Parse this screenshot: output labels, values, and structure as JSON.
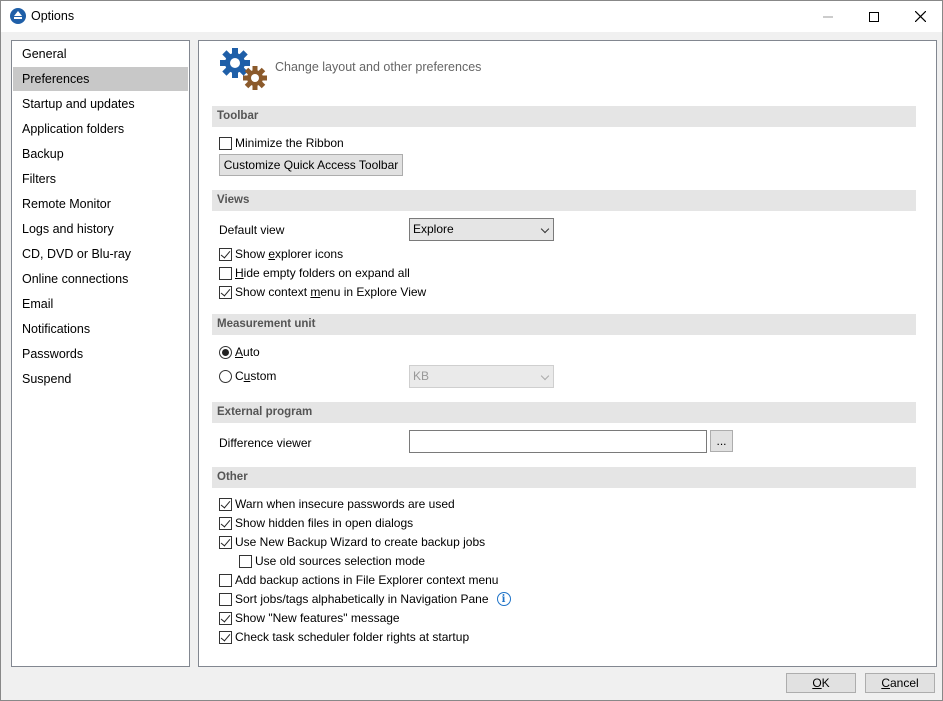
{
  "window": {
    "title": "Options",
    "controls": {
      "minimize": "—",
      "maximize": "☐",
      "close": "✕"
    }
  },
  "sidebar": {
    "items": [
      {
        "label": "General"
      },
      {
        "label": "Preferences",
        "selected": true
      },
      {
        "label": "Startup and updates"
      },
      {
        "label": "Application folders"
      },
      {
        "label": "Backup"
      },
      {
        "label": "Filters"
      },
      {
        "label": "Remote Monitor"
      },
      {
        "label": "Logs and history"
      },
      {
        "label": "CD, DVD or Blu-ray"
      },
      {
        "label": "Online connections"
      },
      {
        "label": "Email"
      },
      {
        "label": "Notifications"
      },
      {
        "label": "Passwords"
      },
      {
        "label": "Suspend"
      }
    ]
  },
  "header": {
    "text": "Change layout and other preferences",
    "icon": "gears-icon",
    "colors": {
      "gear_primary": "#1f5fa8",
      "gear_secondary": "#8b5a2b"
    }
  },
  "toolbar": {
    "section": "Toolbar",
    "minimize_ribbon": {
      "label": "Minimize the Ribbon",
      "checked": false
    },
    "customize_button": "Customize Quick Access Toolbar"
  },
  "views": {
    "section": "Views",
    "default_view_label": "Default view",
    "default_view_value": "Explore",
    "show_explorer_icons": {
      "pre": "Show ",
      "ul": "e",
      "post": "xplorer icons",
      "checked": true
    },
    "hide_empty_folders": {
      "pre": "",
      "ul": "H",
      "post": "ide empty folders on expand all",
      "checked": false
    },
    "show_context_menu": {
      "pre": "Show context ",
      "ul": "m",
      "post": "enu in Explore View",
      "checked": true
    }
  },
  "measurement": {
    "section": "Measurement unit",
    "auto": {
      "pre": "",
      "ul": "A",
      "post": "uto",
      "selected": true
    },
    "custom": {
      "pre": "C",
      "ul": "u",
      "post": "stom",
      "selected": false
    },
    "custom_value": "KB"
  },
  "external": {
    "section": "External program",
    "difference_viewer_label": "Difference viewer",
    "difference_viewer_value": "",
    "browse_label": "..."
  },
  "other": {
    "section": "Other",
    "items": [
      {
        "label": "Warn when insecure passwords are used",
        "checked": true
      },
      {
        "label": "Show hidden files in open dialogs",
        "checked": true
      },
      {
        "label": "Use New Backup Wizard to create backup jobs",
        "checked": true
      },
      {
        "label": "Use old sources selection mode",
        "checked": false,
        "indented": true
      },
      {
        "label": "Add backup actions in File Explorer context menu",
        "checked": false
      },
      {
        "label": "Sort jobs/tags alphabetically in Navigation Pane",
        "checked": false,
        "info": "i"
      },
      {
        "label": "Show \"New features\" message",
        "checked": true
      },
      {
        "label": "Check task scheduler folder rights at startup",
        "checked": true
      }
    ]
  },
  "footer": {
    "ok": {
      "ul": "O",
      "post": "K"
    },
    "cancel": {
      "ul": "C",
      "post": "ancel"
    }
  }
}
